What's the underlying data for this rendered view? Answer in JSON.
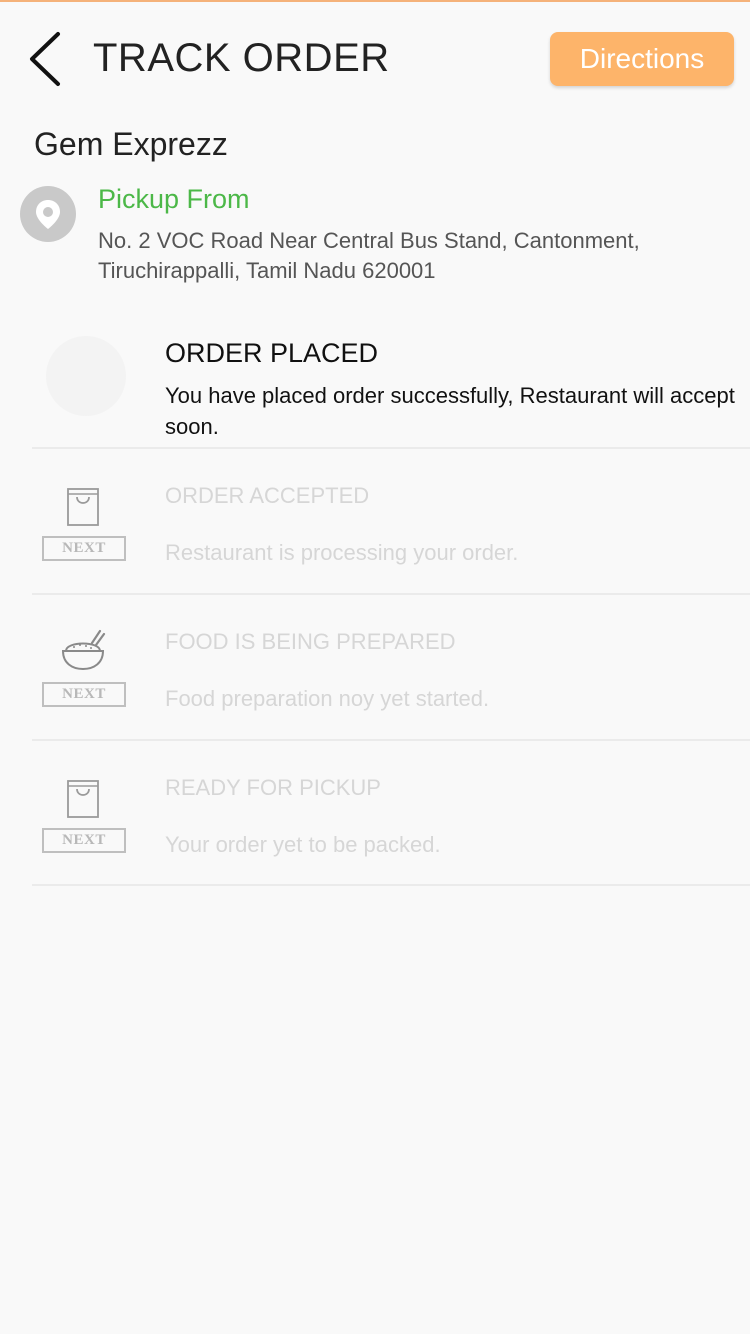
{
  "header": {
    "title": "TRACK ORDER",
    "directions_label": "Directions",
    "back_icon": "chevron-left-icon"
  },
  "restaurant": {
    "name": "Gem Exprezz"
  },
  "pickup": {
    "label": "Pickup From",
    "address": "No. 2 VOC Road Near Central Bus Stand, Cantonment, Tiruchirappalli, Tamil Nadu 620001",
    "icon": "location-pin-icon"
  },
  "steps": [
    {
      "title": "ORDER PLACED",
      "description": "You have placed order successfully, Restaurant will accept soon.",
      "status": "done"
    },
    {
      "title": "ORDER ACCEPTED",
      "description": "Restaurant is processing your order.",
      "status": "pending",
      "badge": "NEXT",
      "icon": "shopping-bag-icon"
    },
    {
      "title": "FOOD IS BEING PREPARED",
      "description": "Food preparation noy yet started.",
      "status": "pending",
      "badge": "NEXT",
      "icon": "food-bowl-icon"
    },
    {
      "title": "READY FOR PICKUP",
      "description": "Your order yet to be packed.",
      "status": "pending",
      "badge": "NEXT",
      "icon": "shopping-bag-icon"
    }
  ],
  "colors": {
    "accent": "#fdb46a",
    "pickup_green": "#4cb848",
    "pending_text": "#d6d6d6"
  }
}
